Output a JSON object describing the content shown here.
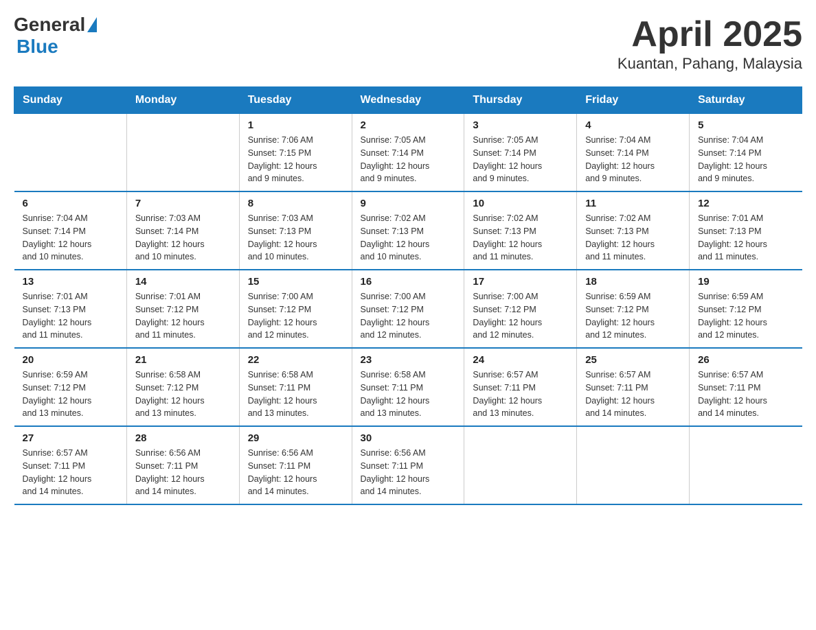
{
  "header": {
    "logo_general": "General",
    "logo_blue": "Blue",
    "title": "April 2025",
    "location": "Kuantan, Pahang, Malaysia"
  },
  "calendar": {
    "days_of_week": [
      "Sunday",
      "Monday",
      "Tuesday",
      "Wednesday",
      "Thursday",
      "Friday",
      "Saturday"
    ],
    "weeks": [
      [
        {
          "day": "",
          "info": ""
        },
        {
          "day": "",
          "info": ""
        },
        {
          "day": "1",
          "info": "Sunrise: 7:06 AM\nSunset: 7:15 PM\nDaylight: 12 hours\nand 9 minutes."
        },
        {
          "day": "2",
          "info": "Sunrise: 7:05 AM\nSunset: 7:14 PM\nDaylight: 12 hours\nand 9 minutes."
        },
        {
          "day": "3",
          "info": "Sunrise: 7:05 AM\nSunset: 7:14 PM\nDaylight: 12 hours\nand 9 minutes."
        },
        {
          "day": "4",
          "info": "Sunrise: 7:04 AM\nSunset: 7:14 PM\nDaylight: 12 hours\nand 9 minutes."
        },
        {
          "day": "5",
          "info": "Sunrise: 7:04 AM\nSunset: 7:14 PM\nDaylight: 12 hours\nand 9 minutes."
        }
      ],
      [
        {
          "day": "6",
          "info": "Sunrise: 7:04 AM\nSunset: 7:14 PM\nDaylight: 12 hours\nand 10 minutes."
        },
        {
          "day": "7",
          "info": "Sunrise: 7:03 AM\nSunset: 7:14 PM\nDaylight: 12 hours\nand 10 minutes."
        },
        {
          "day": "8",
          "info": "Sunrise: 7:03 AM\nSunset: 7:13 PM\nDaylight: 12 hours\nand 10 minutes."
        },
        {
          "day": "9",
          "info": "Sunrise: 7:02 AM\nSunset: 7:13 PM\nDaylight: 12 hours\nand 10 minutes."
        },
        {
          "day": "10",
          "info": "Sunrise: 7:02 AM\nSunset: 7:13 PM\nDaylight: 12 hours\nand 11 minutes."
        },
        {
          "day": "11",
          "info": "Sunrise: 7:02 AM\nSunset: 7:13 PM\nDaylight: 12 hours\nand 11 minutes."
        },
        {
          "day": "12",
          "info": "Sunrise: 7:01 AM\nSunset: 7:13 PM\nDaylight: 12 hours\nand 11 minutes."
        }
      ],
      [
        {
          "day": "13",
          "info": "Sunrise: 7:01 AM\nSunset: 7:13 PM\nDaylight: 12 hours\nand 11 minutes."
        },
        {
          "day": "14",
          "info": "Sunrise: 7:01 AM\nSunset: 7:12 PM\nDaylight: 12 hours\nand 11 minutes."
        },
        {
          "day": "15",
          "info": "Sunrise: 7:00 AM\nSunset: 7:12 PM\nDaylight: 12 hours\nand 12 minutes."
        },
        {
          "day": "16",
          "info": "Sunrise: 7:00 AM\nSunset: 7:12 PM\nDaylight: 12 hours\nand 12 minutes."
        },
        {
          "day": "17",
          "info": "Sunrise: 7:00 AM\nSunset: 7:12 PM\nDaylight: 12 hours\nand 12 minutes."
        },
        {
          "day": "18",
          "info": "Sunrise: 6:59 AM\nSunset: 7:12 PM\nDaylight: 12 hours\nand 12 minutes."
        },
        {
          "day": "19",
          "info": "Sunrise: 6:59 AM\nSunset: 7:12 PM\nDaylight: 12 hours\nand 12 minutes."
        }
      ],
      [
        {
          "day": "20",
          "info": "Sunrise: 6:59 AM\nSunset: 7:12 PM\nDaylight: 12 hours\nand 13 minutes."
        },
        {
          "day": "21",
          "info": "Sunrise: 6:58 AM\nSunset: 7:12 PM\nDaylight: 12 hours\nand 13 minutes."
        },
        {
          "day": "22",
          "info": "Sunrise: 6:58 AM\nSunset: 7:11 PM\nDaylight: 12 hours\nand 13 minutes."
        },
        {
          "day": "23",
          "info": "Sunrise: 6:58 AM\nSunset: 7:11 PM\nDaylight: 12 hours\nand 13 minutes."
        },
        {
          "day": "24",
          "info": "Sunrise: 6:57 AM\nSunset: 7:11 PM\nDaylight: 12 hours\nand 13 minutes."
        },
        {
          "day": "25",
          "info": "Sunrise: 6:57 AM\nSunset: 7:11 PM\nDaylight: 12 hours\nand 14 minutes."
        },
        {
          "day": "26",
          "info": "Sunrise: 6:57 AM\nSunset: 7:11 PM\nDaylight: 12 hours\nand 14 minutes."
        }
      ],
      [
        {
          "day": "27",
          "info": "Sunrise: 6:57 AM\nSunset: 7:11 PM\nDaylight: 12 hours\nand 14 minutes."
        },
        {
          "day": "28",
          "info": "Sunrise: 6:56 AM\nSunset: 7:11 PM\nDaylight: 12 hours\nand 14 minutes."
        },
        {
          "day": "29",
          "info": "Sunrise: 6:56 AM\nSunset: 7:11 PM\nDaylight: 12 hours\nand 14 minutes."
        },
        {
          "day": "30",
          "info": "Sunrise: 6:56 AM\nSunset: 7:11 PM\nDaylight: 12 hours\nand 14 minutes."
        },
        {
          "day": "",
          "info": ""
        },
        {
          "day": "",
          "info": ""
        },
        {
          "day": "",
          "info": ""
        }
      ]
    ]
  }
}
